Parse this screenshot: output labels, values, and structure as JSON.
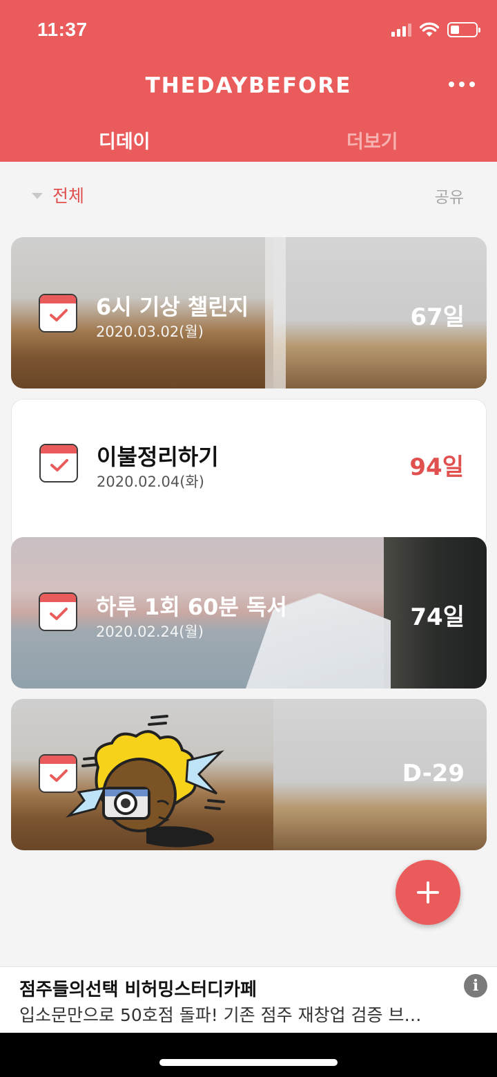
{
  "status_bar": {
    "time": "11:37",
    "battery_level": 0.3
  },
  "header": {
    "logo": "THEDAYBEFORE",
    "more_icon": "ellipsis-icon"
  },
  "tabs": [
    {
      "label": "디데이",
      "active": true
    },
    {
      "label": "더보기",
      "active": false
    }
  ],
  "filter": {
    "label": "전체",
    "share_label": "공유"
  },
  "cards": [
    {
      "title": "6시 기상 챌린지",
      "date": "2020.03.02(월)",
      "count": "67일",
      "background": "book-photo"
    },
    {
      "title": "이불정리하기",
      "date": "2020.02.04(화)",
      "count": "94일",
      "background": "plain-white",
      "count_color": "#e0504f"
    },
    {
      "title": "하루 1회 60분 독서",
      "date": "2020.02.24(월)",
      "count": "74일",
      "background": "airplane-wing-photo"
    },
    {
      "title": "",
      "date": "",
      "count": "D-29",
      "background": "book-photo"
    }
  ],
  "fab_icon": "plus-icon",
  "ad": {
    "title": "점주들의선택 비허밍스터디카페",
    "body": "입소문만으로 50호점 돌파! 기존 점주 재창업 검증 브…",
    "info_icon": "info-icon"
  },
  "colors": {
    "brand": "#ea5b5b",
    "accent_text": "#e0504f"
  }
}
